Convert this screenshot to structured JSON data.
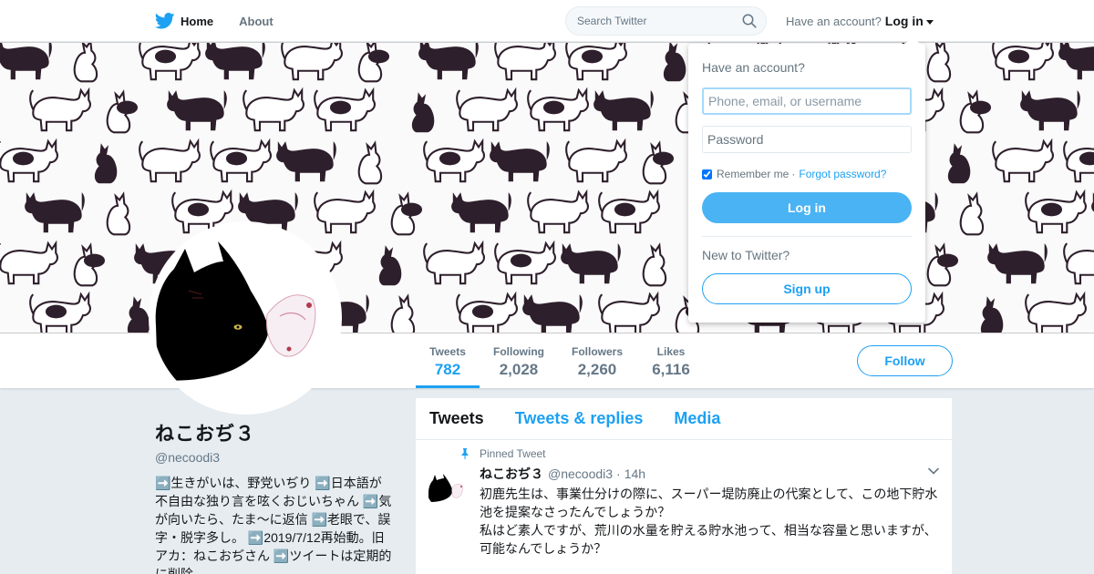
{
  "topnav": {
    "home_label": "Home",
    "about_label": "About",
    "search_placeholder": "Search Twitter",
    "have_account": "Have an account?",
    "login_label": "Log in"
  },
  "profile": {
    "name": "ねこおぢ３",
    "handle": "@necoodi3",
    "bio": "➡️生きがいは、野党いぢり ➡️日本語が不自由な独り言を呟くおじいちゃん ➡️気が向いたら、たま～に返信 ➡️老眼で、誤字・脱字多し。 ➡️2019/7/12再始動。旧アカ：ねこおぢさん ➡️ツイートは定期的に削除"
  },
  "stats": [
    {
      "label": "Tweets",
      "value": "782"
    },
    {
      "label": "Following",
      "value": "2,028"
    },
    {
      "label": "Followers",
      "value": "2,260"
    },
    {
      "label": "Likes",
      "value": "6,116"
    }
  ],
  "follow_label": "Follow",
  "tabs": [
    "Tweets",
    "Tweets & replies",
    "Media"
  ],
  "pinned_tweet": {
    "pinned_label": "Pinned Tweet",
    "name": "ねこおぢ３",
    "handle": "@necoodi3",
    "separator": "·",
    "time": "14h",
    "text": "初鹿先生は、事業仕分けの際に、スーパー堤防廃止の代案として、この地下貯水池を提案なさったんでしょうか？\n私はど素人ですが、荒川の水量を貯える貯水池って、相当な容量と思いますが、可能なんでしょうか？"
  },
  "login_dropdown": {
    "title": "Have an account?",
    "username_placeholder": "Phone, email, or username",
    "password_placeholder": "Password",
    "remember_label": "Remember me",
    "dot": "·",
    "forgot_label": "Forgot password?",
    "login_button": "Log in",
    "new_label": "New to Twitter?",
    "signup_button": "Sign up"
  },
  "colors": {
    "accent": "#1da1f2",
    "login_button": "#4ab3f4",
    "cat_dark": "#2e1f2c",
    "background": "#e6ecf0"
  },
  "icons": [
    "twitter-bird-icon",
    "search-icon",
    "caret-down-icon",
    "pin-icon",
    "chevron-down-icon"
  ]
}
